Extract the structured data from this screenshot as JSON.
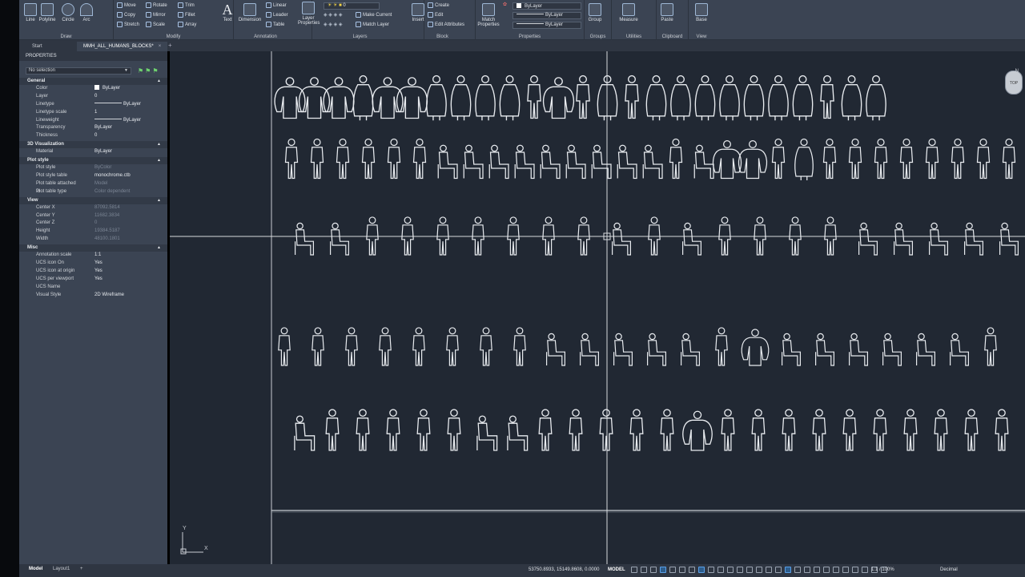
{
  "ribbon": {
    "draw": {
      "title": "Draw",
      "line": "Line",
      "polyline": "Polyline",
      "circle": "Circle",
      "arc": "Arc"
    },
    "modify": {
      "title": "Modify",
      "move": "Move",
      "rotate": "Rotate",
      "trim": "Trim",
      "copy": "Copy",
      "mirror": "Mirror",
      "fillet": "Fillet",
      "stretch": "Stretch",
      "scale": "Scale",
      "array": "Array"
    },
    "annotation": {
      "title": "Annotation",
      "text": "Text",
      "dimension": "Dimension",
      "linear": "Linear",
      "leader": "Leader",
      "table": "Table"
    },
    "layers": {
      "title": "Layers",
      "layer_properties": "Layer Properties",
      "layer_value": "0",
      "make_current": "Make Current",
      "match_layer": "Match Layer"
    },
    "block": {
      "title": "Block",
      "insert": "Insert",
      "create": "Create",
      "edit": "Edit",
      "edit_attributes": "Edit Attributes"
    },
    "properties": {
      "title": "Properties",
      "match_properties": "Match Properties",
      "color": "ByLayer",
      "linetype": "ByLayer",
      "lineweight": "ByLayer"
    },
    "groups": {
      "title": "Groups",
      "group": "Group"
    },
    "utilities": {
      "title": "Utilities",
      "measure": "Measure"
    },
    "clipboard": {
      "title": "Clipboard",
      "paste": "Paste"
    },
    "view": {
      "title": "View",
      "base": "Base"
    }
  },
  "tabs": {
    "start": "Start",
    "file": "MMH_ALL_HUMANS_BLOCKS*",
    "close": "×",
    "add": "+"
  },
  "properties_palette": {
    "title": "PROPERTIES",
    "selection": "No selection",
    "sections": {
      "general": {
        "label": "General",
        "rows": [
          {
            "key": "Color",
            "value": "ByLayer"
          },
          {
            "key": "Layer",
            "value": "0"
          },
          {
            "key": "Linetype",
            "value": "ByLayer"
          },
          {
            "key": "Linetype scale",
            "value": "1"
          },
          {
            "key": "Lineweight",
            "value": "ByLayer"
          },
          {
            "key": "Transparency",
            "value": "ByLayer"
          },
          {
            "key": "Thickness",
            "value": "0"
          }
        ]
      },
      "visualization": {
        "label": "3D Visualization",
        "rows": [
          {
            "key": "Material",
            "value": "ByLayer"
          }
        ]
      },
      "plot_style": {
        "label": "Plot style",
        "rows": [
          {
            "key": "Plot style",
            "value": "ByColor"
          },
          {
            "key": "Plot style table",
            "value": "monochrome.ctb"
          },
          {
            "key": "Plot table attached to",
            "value": "Model"
          },
          {
            "key": "Plot table type",
            "value": "Color dependent"
          }
        ]
      },
      "view": {
        "label": "View",
        "rows": [
          {
            "key": "Center X",
            "value": "87092.5814"
          },
          {
            "key": "Center Y",
            "value": "11682.3834"
          },
          {
            "key": "Center Z",
            "value": "0"
          },
          {
            "key": "Height",
            "value": "19384.5187"
          },
          {
            "key": "Width",
            "value": "48100.1801"
          }
        ]
      },
      "misc": {
        "label": "Misc",
        "rows": [
          {
            "key": "Annotation scale",
            "value": "1:1"
          },
          {
            "key": "UCS icon On",
            "value": "Yes"
          },
          {
            "key": "UCS icon at origin",
            "value": "Yes"
          },
          {
            "key": "UCS per viewport",
            "value": "Yes"
          },
          {
            "key": "UCS Name",
            "value": ""
          },
          {
            "key": "Visual Style",
            "value": "2D Wireframe"
          }
        ]
      }
    }
  },
  "canvas": {
    "viewcube_face": "TOP",
    "viewcube_north": "N",
    "ucs_x": "X",
    "ucs_y": "Y"
  },
  "status_bar": {
    "model_tab": "Model",
    "layout_tab": "Layout1",
    "add": "+",
    "coords": "53750.8933, 15149.8608, 0.0000",
    "mode": "MODEL",
    "scale": "1:1 / 100%",
    "units": "Decimal"
  },
  "colors": {
    "background": "#212833",
    "linework": "#e8ebef",
    "panel": "#3b4453",
    "ribbon": "#3b4453"
  }
}
